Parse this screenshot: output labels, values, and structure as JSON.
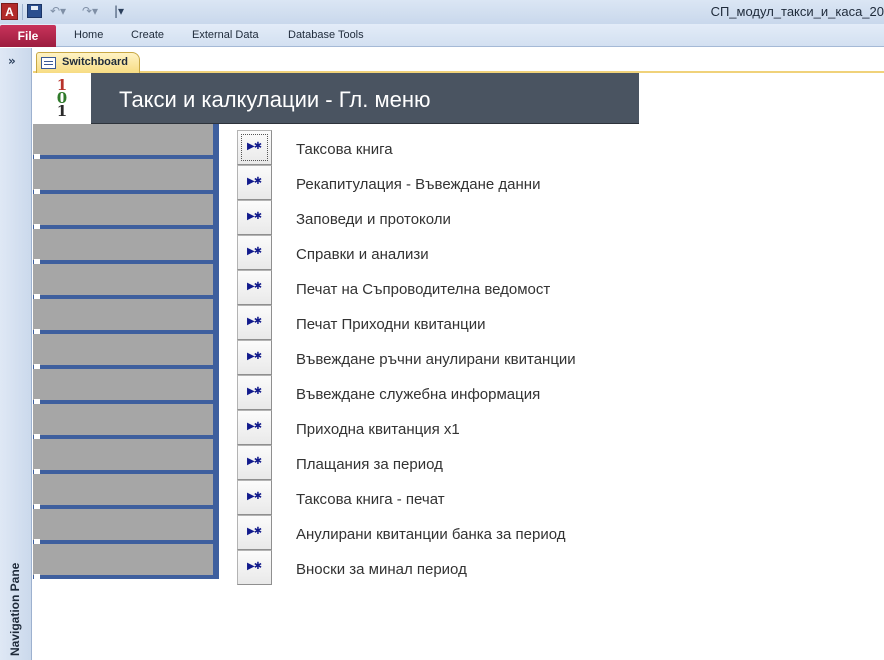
{
  "titlebar": {
    "window_title": "СП_модул_такси_и_каса_20"
  },
  "ribbon": {
    "file": "File",
    "tabs": [
      "Home",
      "Create",
      "External Data",
      "Database Tools"
    ]
  },
  "nav_pane": {
    "label": "Navigation Pane",
    "toggle": "»"
  },
  "doc_tab": {
    "label": "Switchboard"
  },
  "form": {
    "title": "Такси и калкулации - Гл. меню",
    "logo_text": [
      "1",
      "0",
      "1"
    ]
  },
  "colors": {
    "header_bg": "#4a5461",
    "left_fill": "#a6a6a6",
    "left_accent": "#3e5f9e",
    "file_tab": "#b22b4e"
  },
  "switchboard": {
    "items": [
      "Таксова книга",
      "Рекапитулация - Въвеждане данни",
      "Заповеди и протоколи",
      "Справки и анализи",
      "Печат на Съпроводителна ведомост",
      "Печат Приходни квитанции",
      "Въвеждане ръчни анулирани квитанции",
      "Въвеждане служебна информация",
      "Приходна квитанция х1",
      "Плащания за период",
      "Таксова книга - печат",
      "Анулирани квитанции банка за период",
      "Вноски за минал период"
    ]
  }
}
